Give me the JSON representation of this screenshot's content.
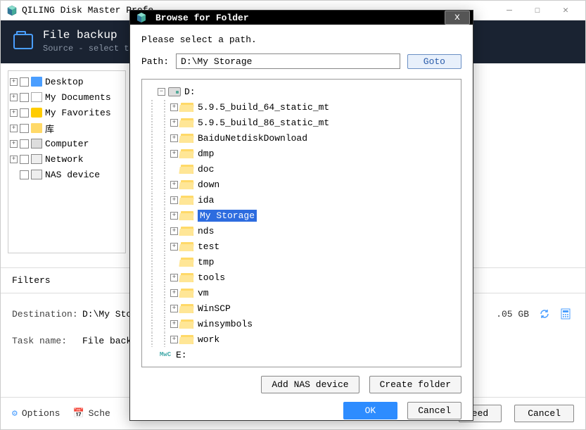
{
  "main": {
    "title": "QILING Disk Master Profe",
    "header": {
      "title": "File backup",
      "subtitle": "Source - select th"
    },
    "tree": [
      {
        "label": "Desktop",
        "icon": "blue",
        "exp": "+"
      },
      {
        "label": "My Documents",
        "icon": "doc",
        "exp": "+"
      },
      {
        "label": "My Favorites",
        "icon": "star",
        "exp": "+"
      },
      {
        "label": "库",
        "icon": "folder",
        "exp": "+"
      },
      {
        "label": "Computer",
        "icon": "pc",
        "exp": "+"
      },
      {
        "label": "Network",
        "icon": "net",
        "exp": "+"
      },
      {
        "label": "NAS device",
        "icon": "nas",
        "exp": " "
      }
    ],
    "filters_label": "Filters",
    "destination_label": "Destination:",
    "destination_value": "D:\\My Stora",
    "task_label": "Task name:",
    "task_value": "File backup",
    "size": ".05 GB",
    "options": "Options",
    "scheme": "Sche",
    "proceed": "eed",
    "cancel": "Cancel"
  },
  "modal": {
    "title": "Browse for Folder",
    "prompt": "Please select a path.",
    "path_label": "Path:",
    "path_value": "D:\\My Storage",
    "goto": "Goto",
    "drives": {
      "d": {
        "label": "D:",
        "children": [
          {
            "label": "5.9.5_build_64_static_mt",
            "exp": "+"
          },
          {
            "label": "5.9.5_build_86_static_mt",
            "exp": "+"
          },
          {
            "label": "BaiduNetdiskDownload",
            "exp": "+"
          },
          {
            "label": "dmp",
            "exp": "+"
          },
          {
            "label": "doc",
            "exp": " "
          },
          {
            "label": "down",
            "exp": "+"
          },
          {
            "label": "ida",
            "exp": "+"
          },
          {
            "label": "My Storage",
            "exp": "+",
            "selected": true
          },
          {
            "label": "nds",
            "exp": "+"
          },
          {
            "label": "test",
            "exp": "+"
          },
          {
            "label": "tmp",
            "exp": " "
          },
          {
            "label": "tools",
            "exp": "+"
          },
          {
            "label": "vm",
            "exp": "+"
          },
          {
            "label": "WinSCP",
            "exp": "+"
          },
          {
            "label": "winsymbols",
            "exp": "+"
          },
          {
            "label": "work",
            "exp": "+"
          }
        ]
      },
      "e": {
        "label": "E:"
      }
    },
    "add_nas": "Add NAS device",
    "create_folder": "Create folder",
    "ok": "OK",
    "cancel": "Cancel"
  }
}
